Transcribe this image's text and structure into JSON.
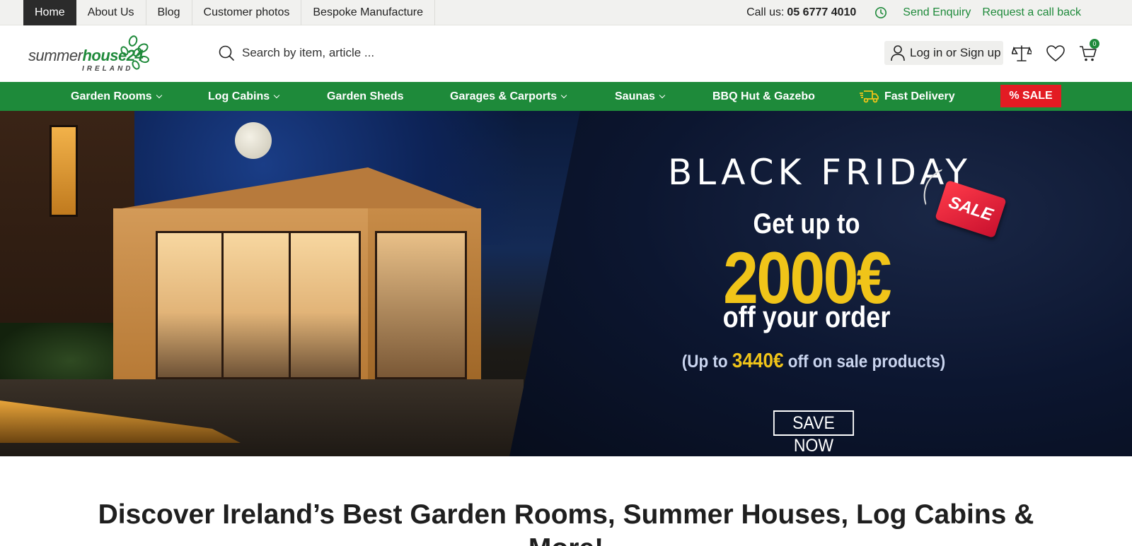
{
  "topbar": {
    "nav": [
      {
        "label": "Home",
        "active": true
      },
      {
        "label": "About Us"
      },
      {
        "label": "Blog"
      },
      {
        "label": "Customer photos"
      },
      {
        "label": "Bespoke Manufacture"
      }
    ],
    "call_label": "Call us:",
    "phone": "05 6777 4010",
    "send_enquiry": "Send Enquiry",
    "request_callback": "Request a call back"
  },
  "header": {
    "logo_text_a": "summer",
    "logo_text_b": "house",
    "logo_text_c": "24",
    "logo_sub": "IRELAND",
    "search_placeholder": "Search by item, article ...",
    "login_label": "Log in or Sign up",
    "cart_count": "0"
  },
  "catnav": {
    "items": [
      {
        "label": "Garden Rooms",
        "dropdown": true
      },
      {
        "label": "Log Cabins",
        "dropdown": true
      },
      {
        "label": "Garden Sheds",
        "dropdown": false
      },
      {
        "label": "Garages & Carports",
        "dropdown": true
      },
      {
        "label": "Saunas",
        "dropdown": true
      },
      {
        "label": "BBQ Hut & Gazebo",
        "dropdown": false
      },
      {
        "label": "Fast Delivery",
        "dropdown": false,
        "icon": "truck-icon"
      }
    ],
    "sale_label": "% SALE"
  },
  "hero": {
    "title": "BLACK FRIDAY",
    "tag": "SALE",
    "line1": "Get up to",
    "amount": "2000€",
    "line2": "off your order",
    "upto_prefix": "(Up to ",
    "upto_amount": "3440€",
    "upto_suffix": " off on sale products)",
    "cta": "SAVE NOW"
  },
  "headline": "Discover Ireland’s Best Garden Rooms, Summer Houses, Log Cabins & More!",
  "colors": {
    "brand_green": "#1e8a3a",
    "sale_red": "#e31b23",
    "promo_yellow": "#f0c419"
  }
}
